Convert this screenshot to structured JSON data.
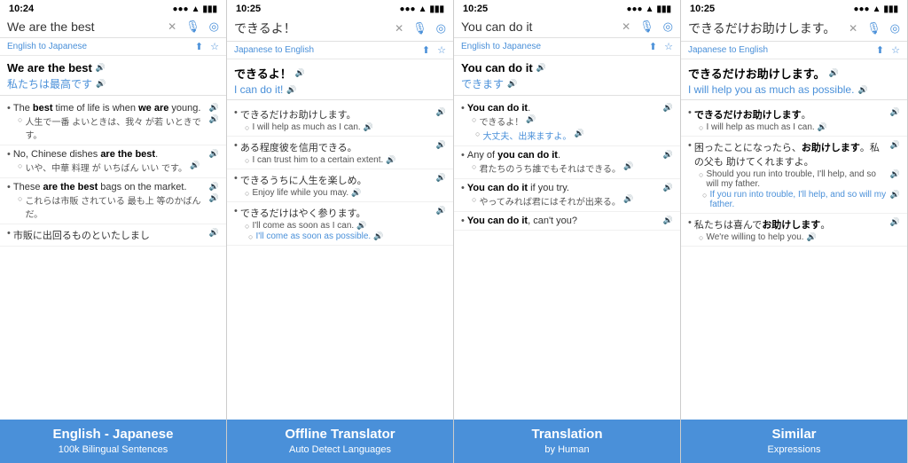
{
  "panels": [
    {
      "id": "panel1",
      "status_time": "10:24",
      "top_bar_text": "We are the best",
      "lang_label": "English to Japanese",
      "source_text": "We are the best",
      "target_text": "私たちは最高です",
      "examples": [
        {
          "en_bullet": "•",
          "en_text": "The best time of life is when we are young.",
          "en_bold": [
            "best",
            "we are"
          ],
          "jp_circle": "○",
          "jp_text": "人生で一番 よいときは、我々 が若 いときです。",
          "sub": []
        },
        {
          "en_bullet": "•",
          "en_text": "No, Chinese dishes are the best.",
          "en_bold": [
            "are the best"
          ],
          "jp_circle": "○",
          "jp_text": "いや、中華 料理 が いちばん いい です。",
          "sub": []
        },
        {
          "en_bullet": "•",
          "en_text": "These are the best bags on the market.",
          "en_bold": [
            "are the best"
          ],
          "jp_circle": "○",
          "jp_text": "これらは市販 されている 最も上 等のかばんだ。",
          "sub": []
        },
        {
          "en_bullet": "•",
          "en_text": "市販に出回るものといたしまし",
          "en_bold": [],
          "jp_circle": "",
          "jp_text": "",
          "sub": []
        }
      ],
      "banner_main": "English - Japanese",
      "banner_sub": "100k Bilingual Sentences"
    },
    {
      "id": "panel2",
      "status_time": "10:25",
      "top_bar_text": "できるよ！",
      "lang_label": "Japanese to English",
      "source_text": "できるよ！",
      "target_text": "I can do it!",
      "examples": [
        {
          "en_bullet": "•",
          "en_text": "できるだけお助けします。",
          "en_bold": [],
          "jp_circle": "○",
          "jp_text": "I will help as much as I can.",
          "sub": []
        },
        {
          "en_bullet": "•",
          "en_text": "ある程度彼を信用できる。",
          "en_bold": [],
          "jp_circle": "○",
          "jp_text": "I can trust him to a certain extent.",
          "sub": []
        },
        {
          "en_bullet": "•",
          "en_text": "できるうちに人生を楽しめ。",
          "en_bold": [],
          "jp_circle": "○",
          "jp_text": "Enjoy life while you may.",
          "sub": []
        },
        {
          "en_bullet": "•",
          "en_text": "できるだけはやく参ります。",
          "en_bold": [],
          "jp_circle": "○",
          "jp_text": "I'll come as soon as I can.",
          "sub": [
            "I'll come as soon as possible."
          ]
        }
      ],
      "banner_main": "Offline Translator",
      "banner_sub": "Auto Detect Languages"
    },
    {
      "id": "panel3",
      "status_time": "10:25",
      "top_bar_text": "You can do it",
      "lang_label": "English to Japanese",
      "source_text": "You can do it",
      "target_text": "できます",
      "examples": [
        {
          "en_bullet": "•",
          "en_text": "You can do it.",
          "en_bold": [
            "You can do it"
          ],
          "jp_circle": "○",
          "jp_text": "できるよ！",
          "sub": [
            "大丈夫、出来ますよ。"
          ]
        },
        {
          "en_bullet": "•",
          "en_text": "Any of you can do it.",
          "en_bold": [
            "you can do it"
          ],
          "jp_circle": "○",
          "jp_text": "君たちのうち誰でもそれはできる。",
          "sub": []
        },
        {
          "en_bullet": "•",
          "en_text": "You can do it if you try.",
          "en_bold": [
            "You can do it"
          ],
          "jp_circle": "○",
          "jp_text": "やってみれば君にはそれが出来る。",
          "sub": []
        },
        {
          "en_bullet": "•",
          "en_text": "You can do it, can't you?",
          "en_bold": [
            "You can do it"
          ],
          "jp_circle": "",
          "jp_text": "",
          "sub": []
        }
      ],
      "banner_main": "Translation",
      "banner_sub": "by Human"
    },
    {
      "id": "panel4",
      "status_time": "10:25",
      "top_bar_text": "できるだけお助けします。",
      "lang_label": "Japanese to English",
      "source_text": "できるだけお助けします。",
      "target_text": "I will help you as much as possible.",
      "examples": [
        {
          "en_bullet": "•",
          "en_text": "できるだけお助けします。",
          "en_bold": [
            "できるだけ",
            "お助けします"
          ],
          "jp_circle": "○",
          "jp_text": "I will help as much as I can.",
          "sub": []
        },
        {
          "en_bullet": "•",
          "en_text": "困ったことになったら、お助けします。私の父も 助けてくれますよ。",
          "en_bold": [
            "お助けします"
          ],
          "jp_circle": "○",
          "jp_text": "Should you run into trouble, I'll help, and so will my father.",
          "sub": [
            "If you run into trouble, I'll help, and so will my father."
          ]
        },
        {
          "en_bullet": "•",
          "en_text": "私たちは喜んでお助けします。",
          "en_bold": [
            "お助けします"
          ],
          "jp_circle": "○",
          "jp_text": "We're willing to help you.",
          "sub": []
        }
      ],
      "banner_main": "Similar",
      "banner_sub": "Expressions"
    }
  ]
}
